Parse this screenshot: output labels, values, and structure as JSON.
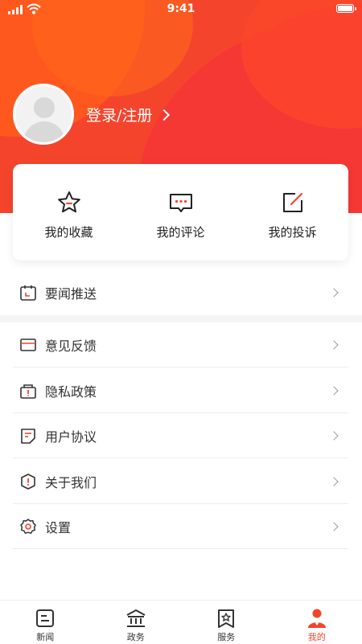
{
  "status_bar": {
    "time": "9:41"
  },
  "profile": {
    "login_label": "登录/注册"
  },
  "quick_actions": [
    {
      "label": "我的收藏",
      "icon": "star-icon"
    },
    {
      "label": "我的评论",
      "icon": "comment-icon"
    },
    {
      "label": "我的投诉",
      "icon": "edit-icon"
    }
  ],
  "menu": [
    {
      "label": "要闻推送",
      "icon": "calendar-icon"
    },
    {
      "label": "意见反馈",
      "icon": "envelope-icon"
    },
    {
      "label": "隐私政策",
      "icon": "lock-icon"
    },
    {
      "label": "用户协议",
      "icon": "document-icon"
    },
    {
      "label": "关于我们",
      "icon": "info-shield-icon"
    },
    {
      "label": "设置",
      "icon": "gear-icon"
    }
  ],
  "tabs": [
    {
      "label": "新闻",
      "icon": "news-icon",
      "active": false
    },
    {
      "label": "政务",
      "icon": "government-icon",
      "active": false
    },
    {
      "label": "服务",
      "icon": "service-icon",
      "active": false
    },
    {
      "label": "我的",
      "icon": "user-icon",
      "active": true
    }
  ],
  "colors": {
    "accent": "#f4452c",
    "header_red": "#f4452c",
    "header_orange": "#ff5a1e"
  }
}
